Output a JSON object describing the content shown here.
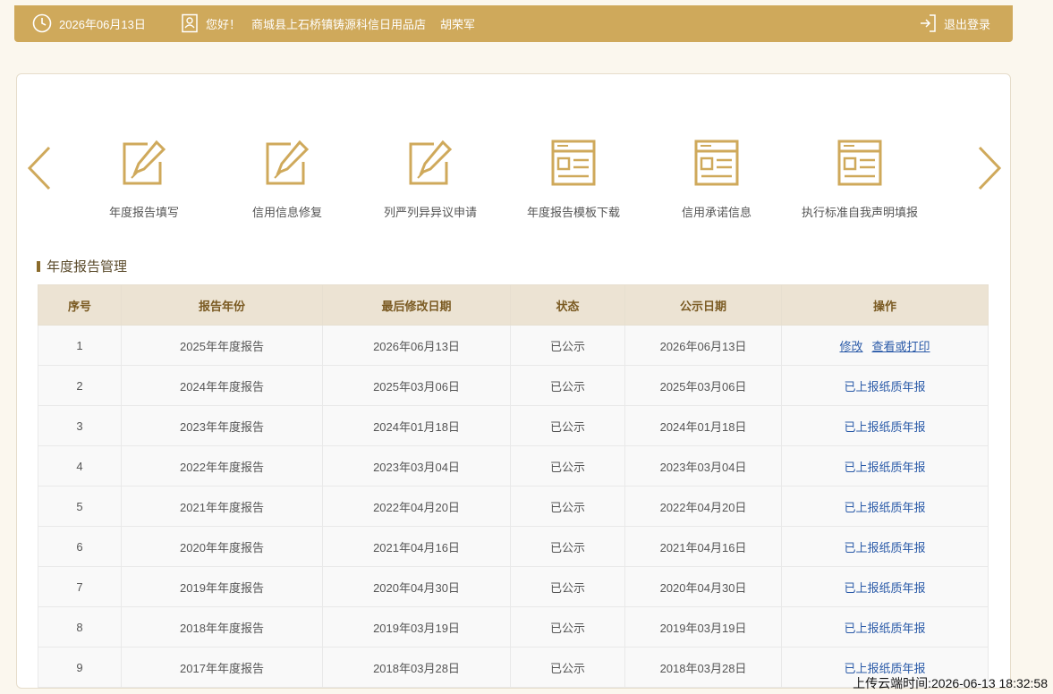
{
  "topbar": {
    "date": "2026年06月13日",
    "greeting": "您好！",
    "shop_name": "商城县上石桥镇铸源科信日用品店",
    "user_name": "胡荣军",
    "logout_label": "退出登录"
  },
  "quick_links": [
    {
      "label": "年度报告填写",
      "icon": "edit-icon"
    },
    {
      "label": "信用信息修复",
      "icon": "edit-icon"
    },
    {
      "label": "列严列异异议申请",
      "icon": "edit-icon"
    },
    {
      "label": "年度报告模板下载",
      "icon": "form-icon"
    },
    {
      "label": "信用承诺信息",
      "icon": "form-icon"
    },
    {
      "label": "执行标准自我声明填报",
      "icon": "form-icon"
    }
  ],
  "section_title": "年度报告管理",
  "table": {
    "headers": [
      "序号",
      "报告年份",
      "最后修改日期",
      "状态",
      "公示日期",
      "操作"
    ],
    "rows": [
      {
        "no": "1",
        "year": "2025年年度报告",
        "modified": "2026年06月13日",
        "status": "已公示",
        "published": "2026年06月13日",
        "op1": "修改",
        "op2": "查看或打印"
      },
      {
        "no": "2",
        "year": "2024年年度报告",
        "modified": "2025年03月06日",
        "status": "已公示",
        "published": "2025年03月06日",
        "op1": "已上报纸质年报"
      },
      {
        "no": "3",
        "year": "2023年年度报告",
        "modified": "2024年01月18日",
        "status": "已公示",
        "published": "2024年01月18日",
        "op1": "已上报纸质年报"
      },
      {
        "no": "4",
        "year": "2022年年度报告",
        "modified": "2023年03月04日",
        "status": "已公示",
        "published": "2023年03月04日",
        "op1": "已上报纸质年报"
      },
      {
        "no": "5",
        "year": "2021年年度报告",
        "modified": "2022年04月20日",
        "status": "已公示",
        "published": "2022年04月20日",
        "op1": "已上报纸质年报"
      },
      {
        "no": "6",
        "year": "2020年年度报告",
        "modified": "2021年04月16日",
        "status": "已公示",
        "published": "2021年04月16日",
        "op1": "已上报纸质年报"
      },
      {
        "no": "7",
        "year": "2019年年度报告",
        "modified": "2020年04月30日",
        "status": "已公示",
        "published": "2020年04月30日",
        "op1": "已上报纸质年报"
      },
      {
        "no": "8",
        "year": "2018年年度报告",
        "modified": "2019年03月19日",
        "status": "已公示",
        "published": "2019年03月19日",
        "op1": "已上报纸质年报"
      },
      {
        "no": "9",
        "year": "2017年年度报告",
        "modified": "2018年03月28日",
        "status": "已公示",
        "published": "2018年03月28日",
        "op1": "已上报纸质年报"
      }
    ]
  },
  "upload_time": "上传云端时间:2026-06-13 18:32:58",
  "colors": {
    "accent": "#cfa95b",
    "header_bg": "#ece3d3",
    "link": "#2a5aa8"
  }
}
